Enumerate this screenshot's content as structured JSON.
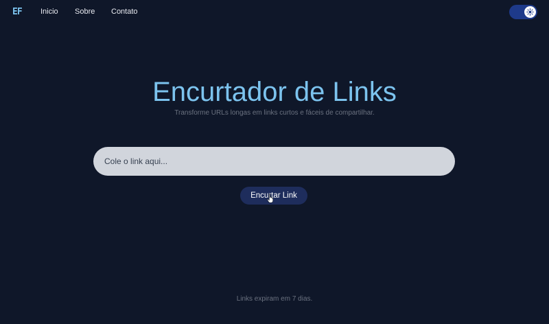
{
  "navbar": {
    "logo": "EF",
    "links": [
      "Inicio",
      "Sobre",
      "Contato"
    ],
    "theme_toggle": {
      "state": "on",
      "icon": "sun-icon"
    }
  },
  "hero": {
    "title": "Encurtador de Links",
    "subtitle": "Transforme URLs longas em links curtos e fáceis de compartilhar."
  },
  "form": {
    "input_placeholder": "Cole o link aqui...",
    "input_value": "",
    "button_label": "Encurtar Link"
  },
  "footer": {
    "note": "Links expiram em 7 dias."
  },
  "colors": {
    "background": "#0f1729",
    "accent": "#7cc3ee",
    "input_background": "#d1d5dc",
    "button_background": "#1e2d5c",
    "toggle_background": "#1e3a8a",
    "muted_text": "#6b7280"
  }
}
